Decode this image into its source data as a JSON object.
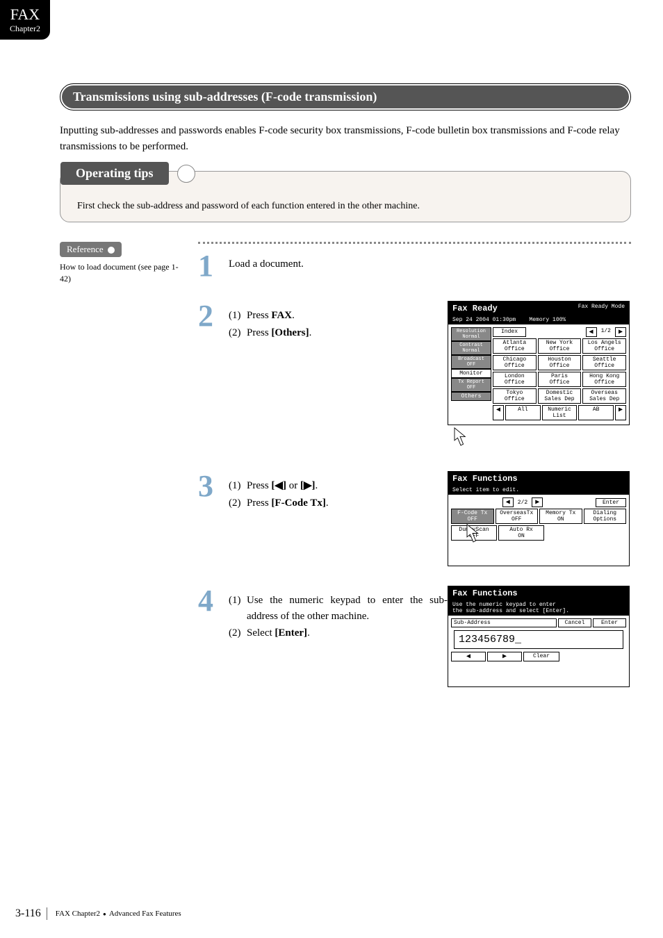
{
  "tab": {
    "title": "FAX",
    "subtitle": "Chapter2"
  },
  "section_title": "Transmissions using sub-addresses (F-code transmission)",
  "intro": "Inputting sub-addresses and passwords enables F-code security box transmissions, F-code bulletin box transmissions and F-code relay transmissions to be performed.",
  "tips": {
    "title": "Operating tips",
    "text": "First check the sub-address and password of each function entered in the other machine."
  },
  "reference": {
    "label": "Reference",
    "text": "How to load document (see page 1-42)"
  },
  "steps": {
    "s1": {
      "num": "1",
      "text": "Load a document."
    },
    "s2": {
      "num": "2",
      "l1a": "(1)",
      "l1b": "Press ",
      "l1c": "FAX",
      "l1d": ".",
      "l2a": "(2)",
      "l2b": "Press ",
      "l2c": "[Others]",
      "l2d": "."
    },
    "s3": {
      "num": "3",
      "l1a": "(1)",
      "l1b": "Press ",
      "l1c": "[◀]",
      "l1d": " or ",
      "l1e": "[▶]",
      "l1f": ".",
      "l2a": "(2)",
      "l2b": "Press ",
      "l2c": "[F-Code Tx]",
      "l2d": "."
    },
    "s4": {
      "num": "4",
      "l1a": "(1)",
      "l1b": "Use the numeric keypad to enter the sub-address of the other machine.",
      "l2a": "(2)",
      "l2b": "Select ",
      "l2c": "[Enter]",
      "l2d": "."
    }
  },
  "screen2": {
    "title": "Fax Ready",
    "mode": "Fax Ready Mode",
    "datetime": "Sep 24 2004 01:30pm",
    "memory": "Memory   100%",
    "left": [
      "Resolution\nNormal",
      "Contrast\nNormal",
      "Broadcast\nOFF",
      "Monitor",
      "Tx Report\nOFF",
      "Others"
    ],
    "index": "Index",
    "pager": "1/2",
    "grid": [
      [
        "Atlanta Office",
        "New York Office",
        "Los Angels Office"
      ],
      [
        "Chicago Office",
        "Houston Office",
        "Seattle Office"
      ],
      [
        "London Office",
        "Paris Office",
        "Hong Kong Office"
      ],
      [
        "Tokyo Office",
        "Domestic Sales Dep",
        "Overseas Sales Dep"
      ]
    ],
    "bottom": [
      "All",
      "Numeric List",
      "AB"
    ]
  },
  "screen3": {
    "title": "Fax Functions",
    "sub": "Select item to edit.",
    "pager": "2/2",
    "enter": "Enter",
    "row1": [
      "F-Code Tx\nOFF",
      "OverseasTx\nOFF",
      "Memory Tx\nON",
      "Dialing Options"
    ],
    "row2": [
      "DummyScan\nOFF",
      "Auto Rx\nON"
    ]
  },
  "screen4": {
    "title": "Fax Functions",
    "help": "Use the numeric keypad to enter\nthe sub-address and select [Enter].",
    "label": "Sub-Address",
    "cancel": "Cancel",
    "enter": "Enter",
    "value": "123456789_",
    "clear": "Clear"
  },
  "footer": {
    "page": "3-116",
    "text": "FAX Chapter2",
    "text2": "Advanced Fax Features"
  }
}
